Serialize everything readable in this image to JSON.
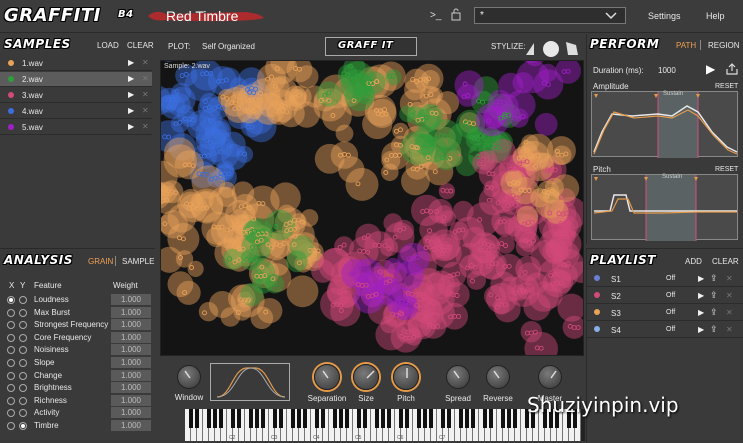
{
  "app": {
    "logo": "GRAFFITI",
    "logo_version": "B4",
    "preset_name": "Red Timbre",
    "terminal_glyph": ">_",
    "preset_selector_value": "*",
    "settings": "Settings",
    "help": "Help"
  },
  "samples": {
    "title": "SAMPLES",
    "load": "LOAD",
    "clear": "CLEAR",
    "items": [
      {
        "name": "1.wav",
        "color": "#e8a25a"
      },
      {
        "name": "2.wav",
        "color": "#2e9e3a"
      },
      {
        "name": "3.wav",
        "color": "#d2497a"
      },
      {
        "name": "4.wav",
        "color": "#3c6ee0"
      },
      {
        "name": "5.wav",
        "color": "#a020c8"
      }
    ]
  },
  "plot": {
    "label": "PLOT:",
    "mode": "Self Organized",
    "graff_button": "GRAFF IT",
    "stylize": "STYLIZE:",
    "canvas_caption": "Sample: 2.wav"
  },
  "analysis": {
    "title": "ANALYSIS",
    "grain": "GRAIN",
    "sample": "SAMPLE",
    "col_x": "X",
    "col_y": "Y",
    "col_feature": "Feature",
    "col_weight": "Weight",
    "features": [
      {
        "name": "Loudness",
        "weight": "1.000",
        "x": true,
        "y": false
      },
      {
        "name": "Max Burst",
        "weight": "1.000",
        "x": false,
        "y": false
      },
      {
        "name": "Strongest Frequency",
        "weight": "1.000",
        "x": false,
        "y": false
      },
      {
        "name": "Core Frequency",
        "weight": "1.000",
        "x": false,
        "y": false
      },
      {
        "name": "Noisiness",
        "weight": "1.000",
        "x": false,
        "y": false
      },
      {
        "name": "Slope",
        "weight": "1.000",
        "x": false,
        "y": false
      },
      {
        "name": "Change",
        "weight": "1.000",
        "x": false,
        "y": false
      },
      {
        "name": "Brightness",
        "weight": "1.000",
        "x": false,
        "y": false
      },
      {
        "name": "Richness",
        "weight": "1.000",
        "x": false,
        "y": false
      },
      {
        "name": "Activity",
        "weight": "1.000",
        "x": false,
        "y": false
      },
      {
        "name": "Timbre",
        "weight": "1.000",
        "x": false,
        "y": true
      }
    ]
  },
  "perform": {
    "title": "PERFORM",
    "path": "PATH",
    "region": "REGION",
    "duration_label": "Duration (ms):",
    "duration_value": "1000",
    "amplitude_label": "Amplitude",
    "pitch_label": "Pitch",
    "reset": "RESET",
    "sustain": "Sustain"
  },
  "playlist": {
    "title": "PLAYLIST",
    "add": "ADD",
    "clear": "CLEAR",
    "items": [
      {
        "name": "S1",
        "state": "Off",
        "color": "#6d7fd4"
      },
      {
        "name": "S2",
        "state": "Off",
        "color": "#d2497a"
      },
      {
        "name": "S3",
        "state": "Off",
        "color": "#e8a25a"
      },
      {
        "name": "S4",
        "state": "Off",
        "color": "#8ab0e8"
      }
    ]
  },
  "controls": {
    "window": "Window",
    "separation": "Separation",
    "size": "Size",
    "pitch": "Pitch",
    "spread": "Spread",
    "reverse": "Reverse",
    "master": "Master"
  },
  "keyboard": {
    "labels": [
      "C2",
      "C3",
      "C4",
      "C5",
      "C6",
      "C7"
    ]
  },
  "watermark": "Shuziyinpin.vip",
  "colors": {
    "accent": "#f0a050",
    "panel": "#3a3a3a",
    "canvas_bg": "#141414"
  }
}
